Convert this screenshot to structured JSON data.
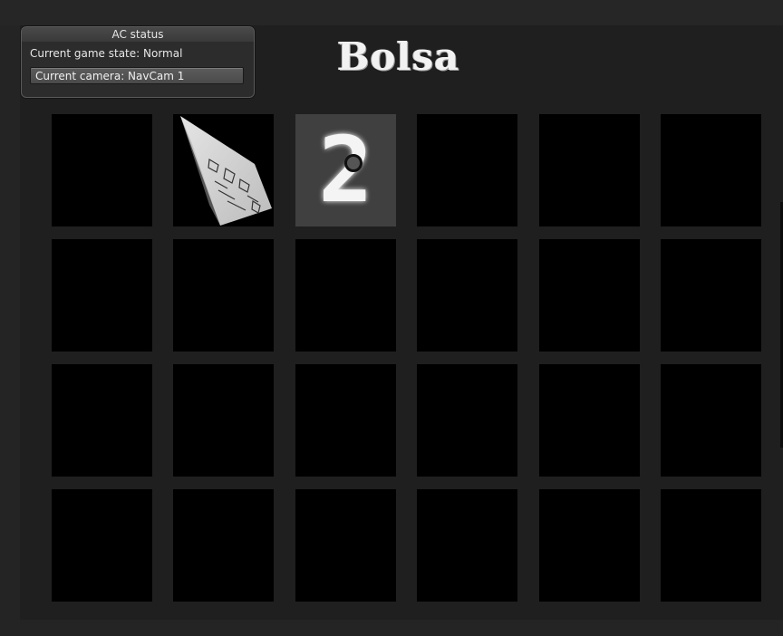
{
  "title": "Bolsa",
  "status": {
    "header": "AC status",
    "game_state": "Current game state: Normal",
    "camera": "Current camera: NavCam 1"
  },
  "grid": {
    "rows": 4,
    "cols": 6,
    "cells": [
      {
        "row": 0,
        "col": 0,
        "state": "hidden"
      },
      {
        "row": 0,
        "col": 1,
        "state": "flipping",
        "image": "card-flip"
      },
      {
        "row": 0,
        "col": 2,
        "state": "revealed",
        "value": "2"
      },
      {
        "row": 0,
        "col": 3,
        "state": "hidden"
      },
      {
        "row": 0,
        "col": 4,
        "state": "hidden"
      },
      {
        "row": 0,
        "col": 5,
        "state": "hidden"
      }
    ]
  }
}
